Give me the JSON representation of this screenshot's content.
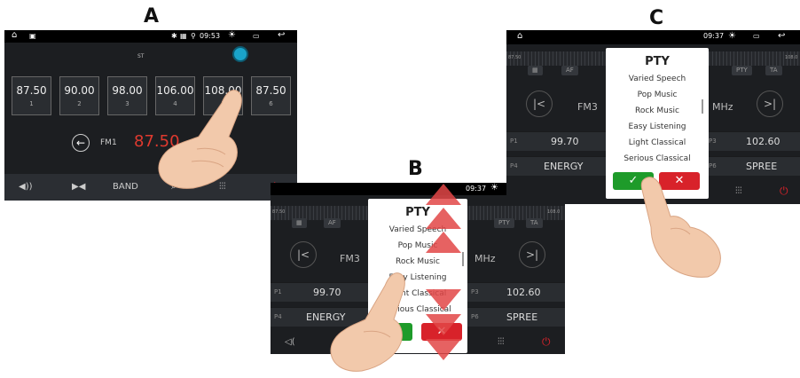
{
  "labels": {
    "a": "A",
    "b": "B",
    "c": "C"
  },
  "screen_a": {
    "status_time": "09:53",
    "stereo": "ST",
    "presets": [
      {
        "freq": "87.50",
        "num": "1"
      },
      {
        "freq": "90.00",
        "num": "2"
      },
      {
        "freq": "98.00",
        "num": "3"
      },
      {
        "freq": "106.00",
        "num": "4"
      },
      {
        "freq": "108.00",
        "num": "5"
      },
      {
        "freq": "87.50",
        "num": "6"
      }
    ],
    "band": "FM1",
    "frequency": "87.50",
    "bottom": {
      "band_label": "BAND"
    },
    "colors": {
      "frequency": "#e03a2f",
      "indicator": "#1aa3c9"
    }
  },
  "screen_b": {
    "status_time": "09:37",
    "tuner_min": "87.50",
    "tuner_max": "108.0",
    "chips": {
      "af": "AF",
      "pty": "PTY",
      "ta": "TA"
    },
    "band": "FM3",
    "unit": "MHz",
    "rows": [
      {
        "p": "P1",
        "v": "99.70"
      },
      {
        "p": "P3",
        "v": "102.60"
      },
      {
        "p": "P4",
        "v": "ENERGY"
      },
      {
        "p": "P6",
        "v": "SPREE"
      }
    ],
    "dialog": {
      "title": "PTY",
      "options": [
        "Varied Speech",
        "Pop Music",
        "Rock Music",
        "Easy Listening",
        "Light Classical",
        "Serious Classical"
      ]
    }
  },
  "screen_c": {
    "status_time": "09:37",
    "tuner_min": "87.50",
    "tuner_max": "108.0",
    "chips": {
      "af": "AF",
      "pty": "PTY",
      "ta": "TA"
    },
    "band": "FM3",
    "unit": "MHz",
    "rows": [
      {
        "p": "P1",
        "v": "99.70"
      },
      {
        "p": "P3",
        "v": "102.60"
      },
      {
        "p": "P4",
        "v": "ENERGY"
      },
      {
        "p": "P6",
        "v": "SPREE"
      }
    ],
    "dialog": {
      "title": "PTY",
      "options": [
        "Varied Speech",
        "Pop Music",
        "Rock Music",
        "Easy Listening",
        "Light Classical",
        "Serious Classical"
      ],
      "confirm_icon": "check-icon",
      "cancel_icon": "close-icon"
    }
  }
}
